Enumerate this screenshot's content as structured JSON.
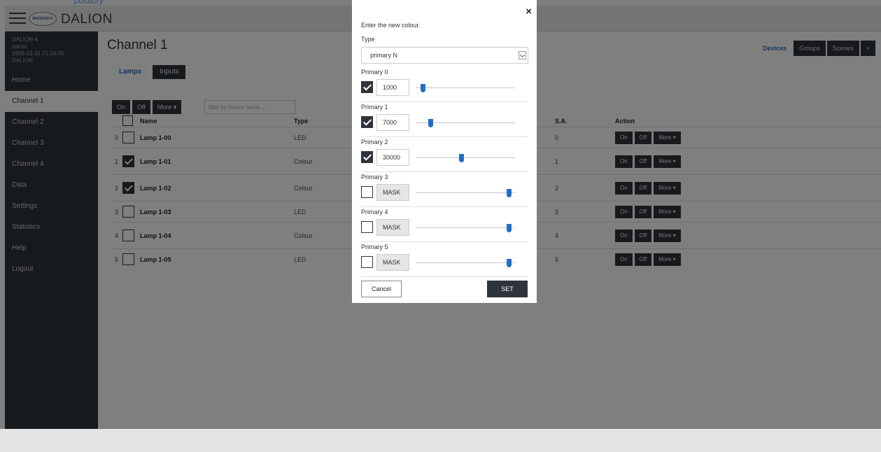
{
  "header": {
    "brand": "DALION",
    "logo_text": "MACROSYS"
  },
  "sidebar": {
    "info": [
      "DALION-4",
      "admin",
      "1999-12-31 21:24:05",
      "DALION"
    ],
    "items": [
      {
        "label": "Home",
        "active": false
      },
      {
        "label": "Channel 1",
        "active": true
      },
      {
        "label": "Channel 2",
        "active": false
      },
      {
        "label": "Channel 3",
        "active": false
      },
      {
        "label": "Channel 4",
        "active": false
      },
      {
        "label": "Data",
        "active": false
      },
      {
        "label": "Settings",
        "active": false
      },
      {
        "label": "Statistics",
        "active": false
      },
      {
        "label": "Help",
        "active": false
      },
      {
        "label": "Logout",
        "active": false
      }
    ]
  },
  "main": {
    "title": "Channel 1",
    "subtabs": [
      "Lamps",
      "Inputs"
    ],
    "righttabs": [
      "Devices",
      "Groups",
      "Scenes",
      "+"
    ],
    "toolbar": [
      "On",
      "Off",
      "More ▾"
    ],
    "search_placeholder": "filter by device name ...",
    "columns": {
      "name": "Name",
      "type": "Type",
      "sa": "S.A.",
      "action": "Action"
    },
    "rows": [
      {
        "index": "0",
        "name": "Lamp 1-00",
        "type": "LED",
        "sa": "0",
        "checked": false
      },
      {
        "index": "1",
        "name": "Lamp 1-01",
        "type": "Colour",
        "sa": "1",
        "checked": true
      },
      {
        "index": "2",
        "name": "Lamp 1-02",
        "type": "Colour",
        "sa": "2",
        "checked": true
      },
      {
        "index": "3",
        "name": "Lamp 1-03",
        "type": "LED",
        "sa": "3",
        "checked": false
      },
      {
        "index": "4",
        "name": "Lamp 1-04",
        "type": "Colour",
        "sa": "4",
        "checked": false
      },
      {
        "index": "5",
        "name": "Lamp 1-05",
        "type": "LED",
        "sa": "5",
        "checked": false
      }
    ],
    "row_actions": [
      "On",
      "Off",
      "More ▾"
    ]
  },
  "modal": {
    "close": "×",
    "title": "Enter the new colour.",
    "type_label": "Type",
    "type_value": "primary N",
    "primaries": [
      {
        "label": "Primary 0",
        "value": "1000",
        "checked": true,
        "level": 0.07
      },
      {
        "label": "Primary 1",
        "value": "7000",
        "checked": true,
        "level": 0.15
      },
      {
        "label": "Primary 2",
        "value": "30000",
        "checked": true,
        "level": 0.46
      },
      {
        "label": "Primary 3",
        "value": "MASK",
        "checked": false,
        "level": 0.94
      },
      {
        "label": "Primary 4",
        "value": "MASK",
        "checked": false,
        "level": 0.94
      },
      {
        "label": "Primary 5",
        "value": "MASK",
        "checked": false,
        "level": 0.94
      }
    ],
    "cancel": "Cancel",
    "set": "SET"
  }
}
